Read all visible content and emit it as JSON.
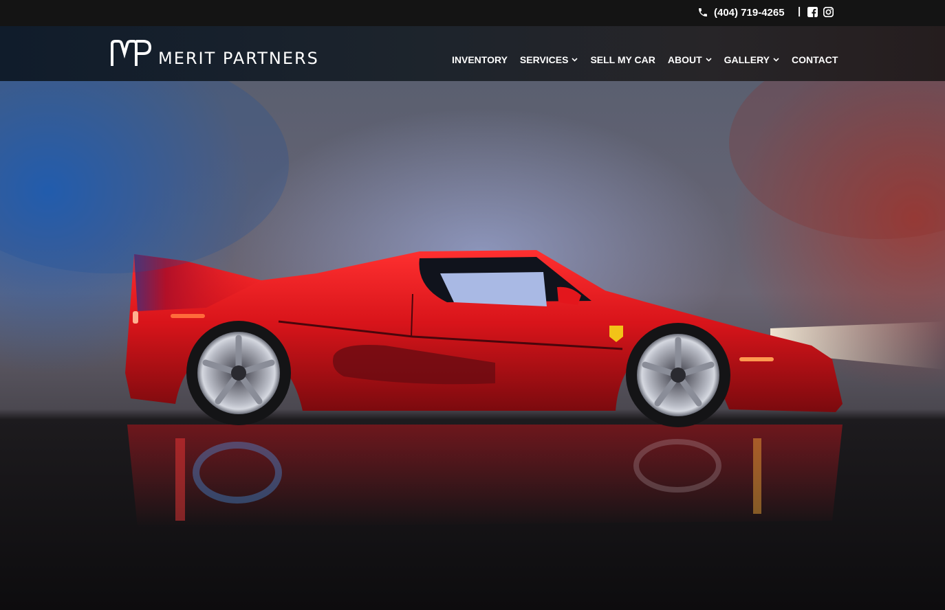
{
  "topbar": {
    "phone": "(404) 719-4265",
    "separator": "|",
    "icons": [
      "phone-icon",
      "facebook-icon",
      "instagram-icon"
    ]
  },
  "brand": {
    "monogram": "MP",
    "name": "MERIT PARTNERS"
  },
  "nav": {
    "items": [
      {
        "label": "INVENTORY",
        "dropdown": false
      },
      {
        "label": "SERVICES",
        "dropdown": true
      },
      {
        "label": "SELL MY CAR",
        "dropdown": false
      },
      {
        "label": "ABOUT",
        "dropdown": true
      },
      {
        "label": "GALLERY",
        "dropdown": true
      },
      {
        "label": "CONTACT",
        "dropdown": false
      }
    ]
  },
  "hero": {
    "subject": "red-sports-car-image",
    "colors": {
      "car": "#d8141a",
      "light_left": "#1f6fd0",
      "light_right": "#b33a2e"
    }
  }
}
